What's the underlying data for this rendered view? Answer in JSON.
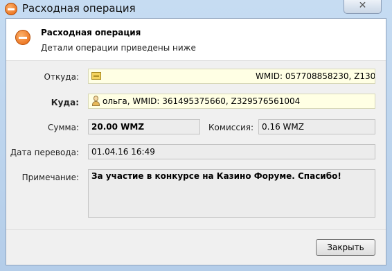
{
  "window": {
    "title": "Расходная операция",
    "close_glyph": "✕"
  },
  "header": {
    "title": "Расходная операция",
    "subtitle": "Детали операции приведены ниже"
  },
  "from": {
    "label": "Откуда:",
    "value": "WMID: 057708858230, Z130..."
  },
  "to": {
    "label": "Куда:",
    "value": "ольга, WMID: 361495375660, Z329576561004"
  },
  "amount": {
    "label": "Сумма:",
    "value": "20.00 WMZ"
  },
  "commission": {
    "label": "Комиссия:",
    "value": "0.16 WMZ"
  },
  "date": {
    "label": "Дата перевода:",
    "value": "01.04.16 16:49"
  },
  "note": {
    "label": "Примечание:",
    "value": "За участие в конкурсе на Казино Форуме. Спасибо!"
  },
  "buttons": {
    "close_label": "Закрыть"
  },
  "icons": {
    "title": "minus-circle-icon",
    "header": "minus-circle-icon",
    "from": "wallet-icon",
    "to": "person-icon"
  },
  "colors": {
    "accent_orange": "#e8630b",
    "field_highlight": "#ffffe4"
  }
}
